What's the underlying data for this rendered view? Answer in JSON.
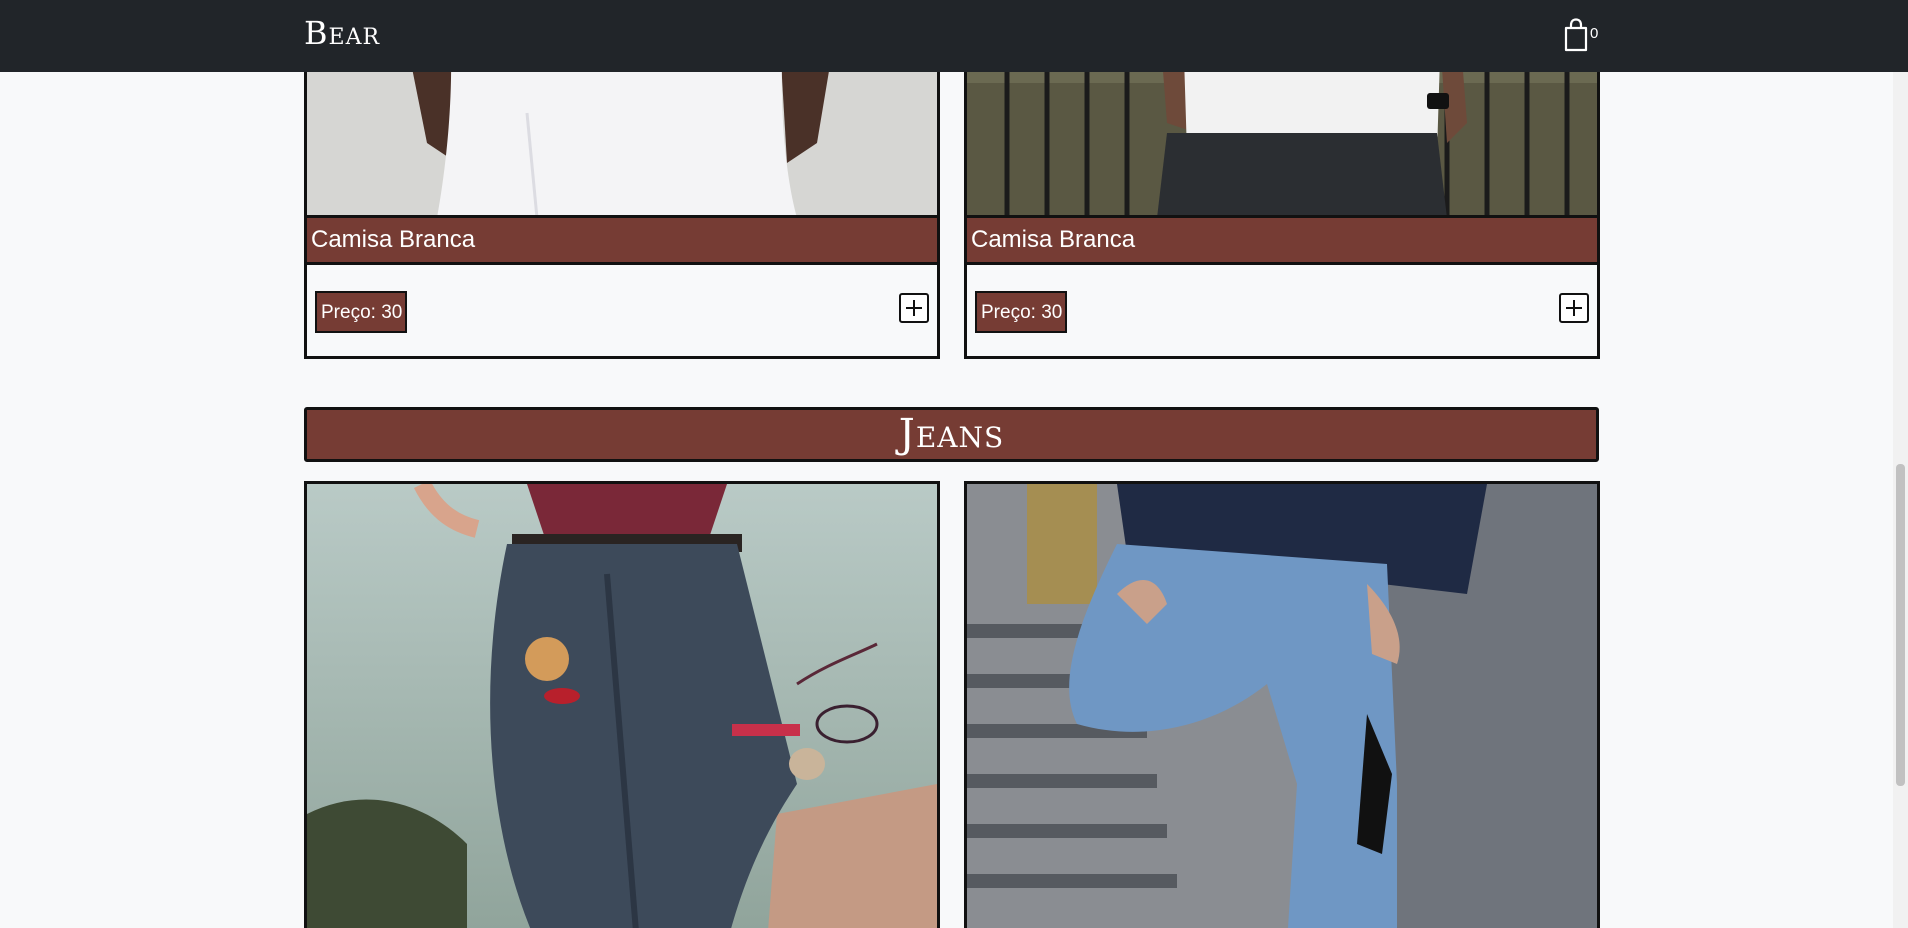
{
  "navbar": {
    "brand": "Bear",
    "cart_count": "0",
    "cart_icon": "shopping-bag-icon"
  },
  "products_top": [
    {
      "title": "Camisa Branca",
      "price": "Preço: 30",
      "add_icon": "plus-square-icon"
    },
    {
      "title": "Camisa Branca",
      "price": "Preço: 30",
      "add_icon": "plus-square-icon"
    }
  ],
  "section": {
    "title": "Jeans"
  },
  "products_jeans": [
    {
      "image": "woman-jeans-photo"
    },
    {
      "image": "man-ripped-jeans-photo"
    }
  ],
  "colors": {
    "navbar": "#212529",
    "accent": "#763c34",
    "background": "#f8f9fa"
  }
}
